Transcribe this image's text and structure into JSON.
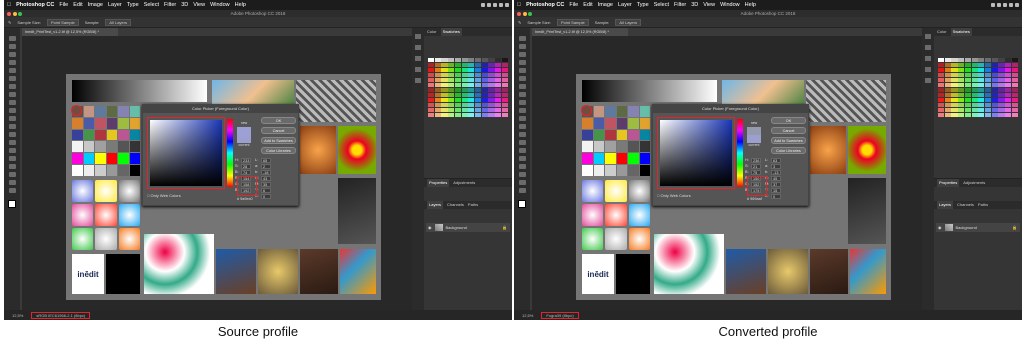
{
  "screens": [
    {
      "app_name": "Photoshop CC",
      "menus": [
        "File",
        "Edit",
        "Image",
        "Layer",
        "Type",
        "Select",
        "Filter",
        "3D",
        "View",
        "Window",
        "Help"
      ],
      "window_title": "Adobe Photoshop CC 2018",
      "doc_tab": "Inedit_PrintTest_v1-2.tif @ 12,5% (RGB/8) *",
      "option_sample_size_label": "Sample Size:",
      "option_sample_size": "Point Sample",
      "option_sample_label": "Sample:",
      "option_sample": "All Layers",
      "picker_title": "Color Picker (Foreground Color)",
      "ok": "OK",
      "cancel": "Cancel",
      "add_swatches": "Add to Swatches",
      "color_libraries": "Color Libraries",
      "new_label": "new",
      "current_label": "current",
      "only_web": "Only Web Colors",
      "h": "233",
      "s": "28",
      "b": "74",
      "r": "154",
      "g": "158",
      "bl": "192",
      "L": "65",
      "a": "2",
      "b2": "-18",
      "c": "43",
      "m": "35",
      "y": "6",
      "k": "0",
      "hex": "9a9ec0",
      "panel_tabs": [
        "Color",
        "Swatches"
      ],
      "layer_tabs": [
        "Properties",
        "Adjustments"
      ],
      "layer_sub_tabs": [
        "Layers",
        "Channels",
        "Paths"
      ],
      "layer_name": "Background",
      "zoom": "12,5%",
      "profile": "sRGB IEC61966-2.1 (8bpc)"
    },
    {
      "app_name": "Photoshop CC",
      "menus": [
        "File",
        "Edit",
        "Image",
        "Layer",
        "Type",
        "Select",
        "Filter",
        "3D",
        "View",
        "Window",
        "Help"
      ],
      "window_title": "Adobe Photoshop CC 2018",
      "doc_tab": "Inedit_PrintTest_v1-2.tif @ 12,5% (RGB/8) *",
      "option_sample_size_label": "Sample Size:",
      "option_sample_size": "Point Sample",
      "option_sample_label": "Sample:",
      "option_sample": "All Layers",
      "picker_title": "Color Picker (Foreground Color)",
      "ok": "OK",
      "cancel": "Cancel",
      "add_swatches": "Add to Swatches",
      "color_libraries": "Color Libraries",
      "new_label": "new",
      "current_label": "current",
      "only_web": "Only Web Colors",
      "h": "236",
      "s": "21",
      "b": "75",
      "r": "150",
      "g": "152",
      "bl": "175",
      "L": "63",
      "a": "3",
      "b2": "-13",
      "c": "45",
      "m": "37",
      "y": "15",
      "k": "0",
      "hex": "969aaf",
      "panel_tabs": [
        "Color",
        "Swatches"
      ],
      "layer_tabs": [
        "Properties",
        "Adjustments"
      ],
      "layer_sub_tabs": [
        "Layers",
        "Channels",
        "Paths"
      ],
      "layer_name": "Background",
      "zoom": "12,5%",
      "profile": "Fogra39 (8bpc)"
    }
  ],
  "captions": {
    "left": "Source profile",
    "right": "Converted profile"
  },
  "colors": {
    "accent_red": "#e0262c",
    "new_swatch_left": "#9da0d4",
    "new_swatch_right": "#969aaf"
  }
}
